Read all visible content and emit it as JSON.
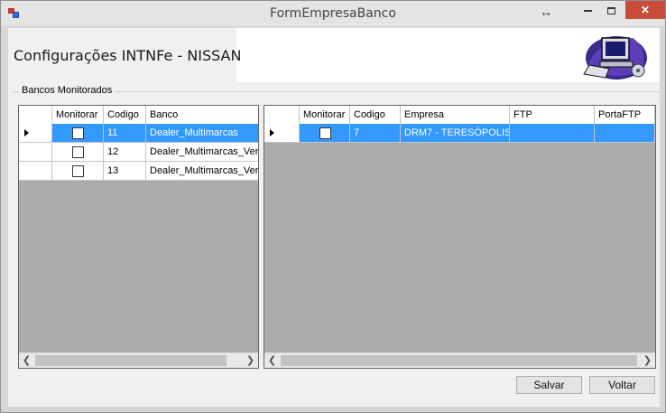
{
  "window": {
    "title": "FormEmpresaBanco"
  },
  "header": {
    "title": "Configurações INTNFe - NISSAN"
  },
  "group": {
    "label": "Bancos Monitorados"
  },
  "left_grid": {
    "columns": [
      "Monitorar",
      "Codigo",
      "Banco"
    ],
    "rows": [
      {
        "monitorar": false,
        "codigo": "11",
        "banco": "Dealer_Multimarcas",
        "selected": true
      },
      {
        "monitorar": false,
        "codigo": "12",
        "banco": "Dealer_Multimarcas_Versao",
        "selected": false
      },
      {
        "monitorar": false,
        "codigo": "13",
        "banco": "Dealer_Multimarcas_Versao",
        "selected": false
      }
    ]
  },
  "right_grid": {
    "columns": [
      "Monitorar",
      "Codigo",
      "Empresa",
      "FTP",
      "PortaFTP"
    ],
    "rows": [
      {
        "monitorar": false,
        "codigo": "7",
        "empresa": "DRM7 - TERESÓPOLIS",
        "ftp": "",
        "portaftp": "",
        "selected": true
      }
    ]
  },
  "buttons": {
    "save_label": "Salvar",
    "back_label": "Voltar"
  },
  "colors": {
    "selection": "#3399ff",
    "grid_background": "#ababab",
    "close_button": "#c74c3c"
  },
  "icons": [
    "app-icon",
    "resize-icon",
    "minimize-icon",
    "maximize-icon",
    "close-icon",
    "computer-logo-icon",
    "row-selector-arrow-icon",
    "scroll-left-icon",
    "scroll-right-icon"
  ]
}
